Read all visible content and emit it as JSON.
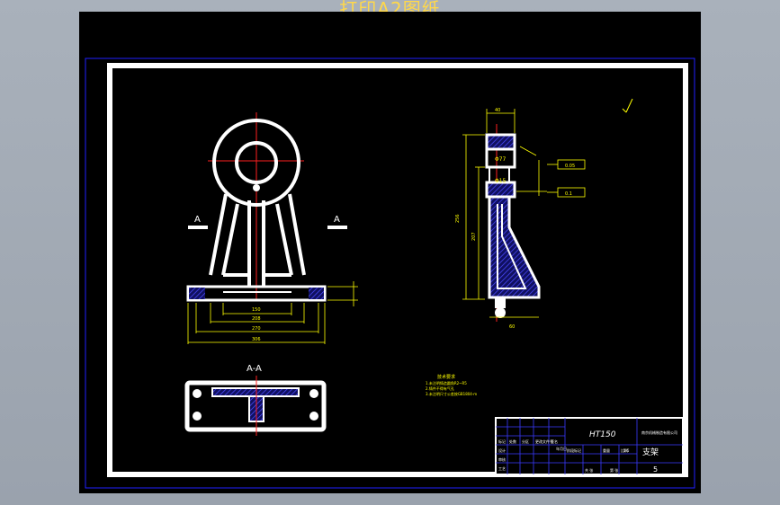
{
  "header": {
    "title": "打印A2图纸"
  },
  "views": {
    "section_label": "A-A",
    "section_mark_left": "A",
    "section_mark_right": "A"
  },
  "dimensions": {
    "front": [
      "150",
      "208",
      "270",
      "306"
    ],
    "side_top": "40",
    "side_left_outer": "256",
    "side_left_inner": "207",
    "side_bottom": "60",
    "side_tol_1": "0.05",
    "side_tol_2": "0.1",
    "side_phi": "Φ77",
    "side_hole": "Φ15"
  },
  "notes": {
    "heading": "技术要求",
    "lines": [
      "1.未注明铸造圆角R2~R5",
      "2.铸件不得有气孔",
      "3.未注明尺寸公差按GB1804-m"
    ]
  },
  "title_block": {
    "material": "HT150",
    "part_name": "支架",
    "sheet": "5",
    "company": "南京机械制造有限公司",
    "labels": [
      "标记",
      "处数",
      "分区",
      "更改文件号",
      "签名",
      "年月日"
    ],
    "stage_labels": [
      "阶段标记",
      "重量",
      "比例"
    ],
    "scale": "1:5",
    "row_labels": [
      "设计",
      "审核",
      "工艺"
    ],
    "sheets": [
      "共 张",
      "第 张"
    ]
  },
  "colors": {
    "background": "#000000",
    "outline": "#ffffff",
    "dimension": "#ffff00",
    "center": "#ff2020",
    "hatch": "#3a3aff",
    "frame": "#2020ff",
    "title": "#ffd84a"
  }
}
